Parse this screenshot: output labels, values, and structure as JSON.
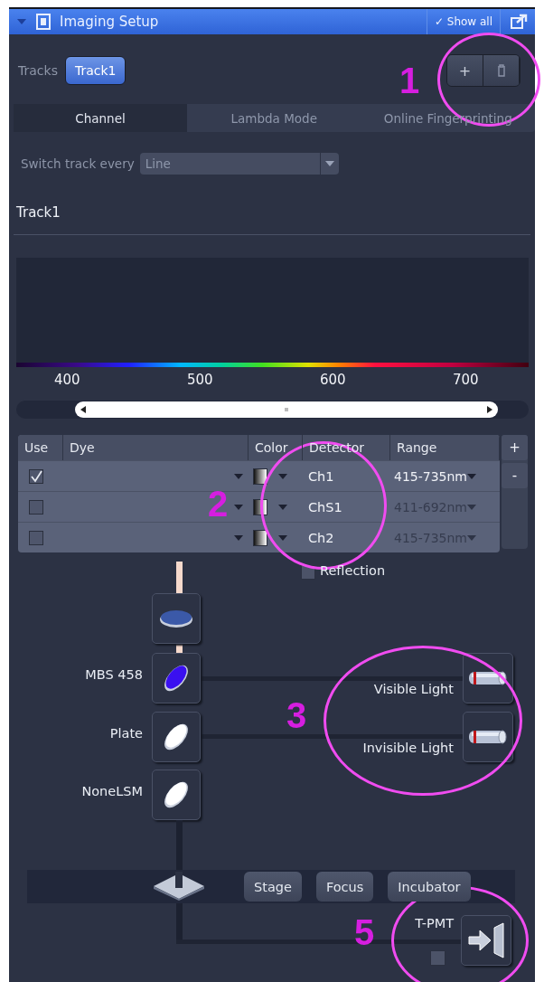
{
  "panel": {
    "title": "Imaging Setup",
    "show_all": "✓ Show all"
  },
  "tracks": {
    "label": "Tracks",
    "items": [
      {
        "label": "Track1",
        "selected": true
      }
    ],
    "add": "+"
  },
  "tabs": [
    {
      "label": "Channel",
      "selected": true
    },
    {
      "label": "Lambda Mode",
      "selected": false
    },
    {
      "label": "Online Fingerprinting",
      "selected": false
    }
  ],
  "switch_track": {
    "label": "Switch track every",
    "value": "Line"
  },
  "track_title": "Track1",
  "spectrum": {
    "labels": [
      "400",
      "500",
      "600",
      "700"
    ]
  },
  "channels": {
    "columns": [
      "Use",
      "Dye",
      "Color",
      "Detector",
      "Range"
    ],
    "add": "+",
    "remove": "-",
    "rows": [
      {
        "use": true,
        "detector": "Ch1",
        "range": "415-735nm",
        "disabled": false
      },
      {
        "use": false,
        "detector": "ChS1",
        "range": "411-692nm",
        "disabled": true
      },
      {
        "use": false,
        "detector": "Ch2",
        "range": "415-735nm",
        "disabled": true
      }
    ]
  },
  "reflection": {
    "label": "Reflection",
    "checked": false
  },
  "beam_path": [
    {
      "kind": "filter"
    },
    {
      "kind": "dichroic",
      "label": "MBS 458"
    },
    {
      "kind": "plate",
      "label": "Plate"
    },
    {
      "kind": "plate",
      "label": "NoneLSM"
    }
  ],
  "light_paths": [
    {
      "label": "Visible Light"
    },
    {
      "label": "Invisible Light"
    }
  ],
  "stage_buttons": [
    "Stage",
    "Focus",
    "Incubator"
  ],
  "tpmt": {
    "label": "T-PMT",
    "checked": false
  },
  "annotations": [
    {
      "label": "1"
    },
    {
      "label": "2"
    },
    {
      "label": "3"
    },
    {
      "label": "5"
    }
  ]
}
